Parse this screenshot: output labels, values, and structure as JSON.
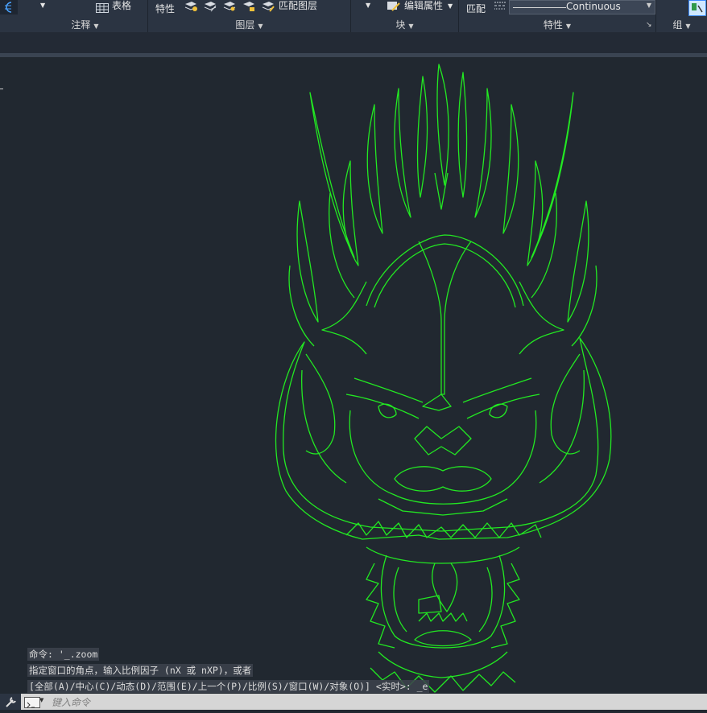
{
  "ribbon": {
    "table_label": "表格",
    "properties_label": "特性",
    "match_layer_label": "匹配图层",
    "edit_attr_label": "编辑属性",
    "match_label": "匹配",
    "linetype_value": "Continuous",
    "panels": {
      "annotation": "注释",
      "layers": "图层",
      "block": "块",
      "properties": "特性",
      "groups": "组"
    }
  },
  "command_history": [
    "命令: '_.zoom",
    "指定窗口的角点，输入比例因子 (nX 或 nXP)，或者",
    "[全部(A)/中心(C)/动态(D)/范围(E)/上一个(P)/比例(S)/窗口(W)/对象(O)] <实时>: _e"
  ],
  "command_input_placeholder": "键入命令",
  "colors": {
    "drawing": "#22e822",
    "canvas": "#212830",
    "ribbon": "#2b3442"
  },
  "icons": [
    "table-icon",
    "layer-icon",
    "edit-attribute-icon",
    "linetype-icon",
    "wrench-icon",
    "command-prompt-icon",
    "group-icon"
  ]
}
